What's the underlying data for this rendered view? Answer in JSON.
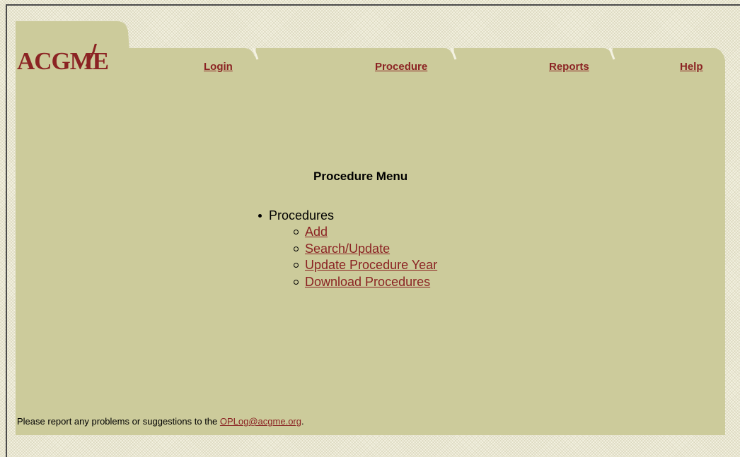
{
  "header": {
    "logo_text": "ACGME",
    "nav": [
      "Login",
      "Procedure",
      "Reports",
      "Help"
    ]
  },
  "main": {
    "title": "Procedure Menu",
    "section_label": "Procedures",
    "links": [
      "Add",
      "Search/Update",
      "Update Procedure Year",
      "Download Procedures"
    ]
  },
  "footer": {
    "text_before": "Please report any problems or suggestions to the ",
    "email": "OPLog@acgme.org",
    "text_after": "."
  },
  "colors": {
    "panel": "#cccb9b",
    "link": "#8b2323",
    "brand": "#8b2323",
    "background": "#f4f2e2"
  }
}
